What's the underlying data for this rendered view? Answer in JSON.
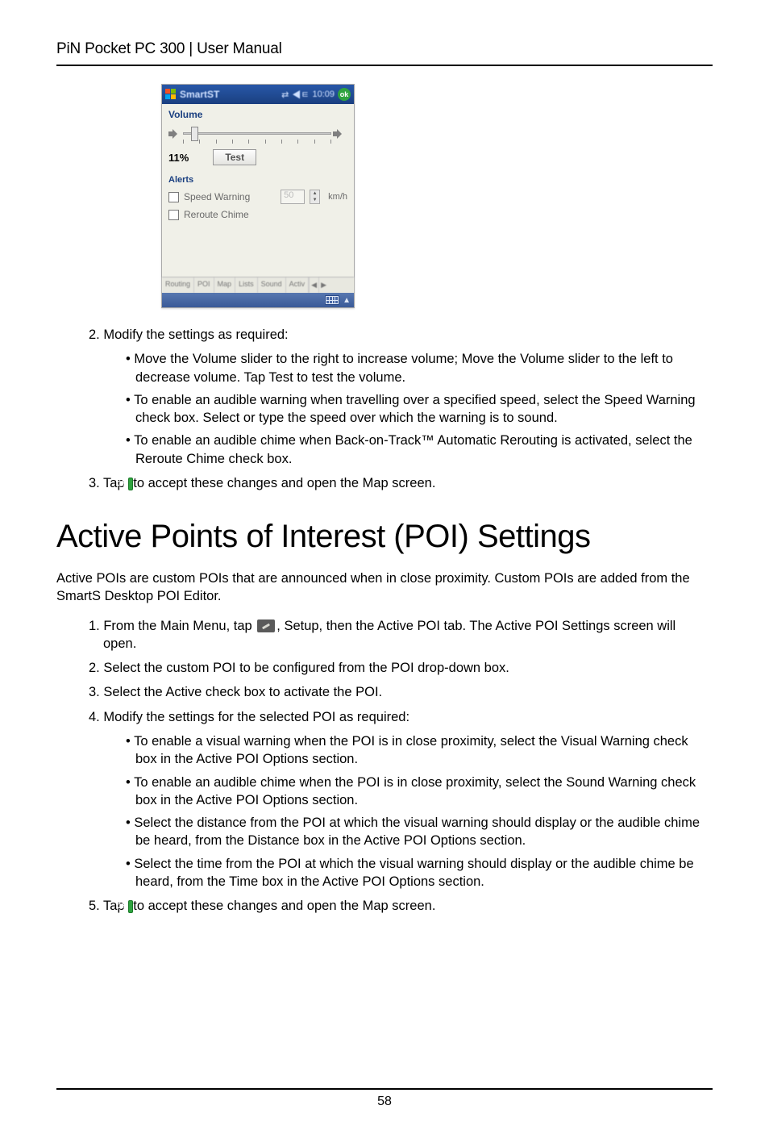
{
  "header": "PiN Pocket PC 300 | User Manual",
  "device": {
    "app_name": "SmartST",
    "time_indicator": "10:09",
    "volume_label": "Volume",
    "percentage": "11%",
    "test_button": "Test",
    "alerts_label": "Alerts",
    "speed_warning_label": "Speed Warning",
    "speed_value": "50",
    "speed_unit": "km/h",
    "reroute_label": "Reroute Chime",
    "tabs": [
      "Routing",
      "POI",
      "Map",
      "Lists",
      "Sound",
      "Activ"
    ],
    "ok_text": "ok"
  },
  "steps1": {
    "s2": "2. Modify the settings as required:",
    "b1": "Move the Volume slider to the right to increase volume; Move the Volume slider to the left to decrease volume. Tap Test to test the volume.",
    "b2": "To enable an audible warning when travelling over a specified speed, select the Speed Warning check box. Select or type the speed over which the warning is to sound.",
    "b3": "To enable an audible chime when Back-on-Track™ Automatic Rerouting is activated, select the Reroute Chime check box.",
    "s3_pre": "3. Tap ",
    "s3_post": "to accept these changes and open the Map screen."
  },
  "heading": "Active Points of Interest (POI) Settings",
  "intro": "Active POIs are custom POIs that are announced when in close proximity. Custom POIs are added from the SmartS Desktop POI Editor.",
  "steps2": {
    "s1_pre": "1. From the Main Menu, tap ",
    "s1_mid": ", ",
    "s1_post": "Setup, then the Active POI tab. The Active POI Settings screen will open.",
    "s2": "2. Select the custom POI to be configured from the POI drop-down box.",
    "s3": "3. Select the Active check box to activate the POI.",
    "s4": "4. Modify the settings for the selected POI as required:",
    "b1": "To enable a visual warning when the POI is in close proximity, select the Visual Warning check box in the Active POI Options section.",
    "b2": "To enable an audible chime when the POI is in close proximity, select the Sound Warning check box in the Active POI Options section.",
    "b3": "Select the distance from the POI at which the visual warning should display or the audible chime be heard, from the Distance box in the Active POI Options section.",
    "b4": "Select the time from the POI at which the visual warning should display or the audible chime be heard, from the Time box in the Active POI Options section.",
    "s5_pre": "5. Tap ",
    "s5_post": "to accept these changes and open the Map screen."
  },
  "inline_ok_text": "ok",
  "page_number": "58"
}
